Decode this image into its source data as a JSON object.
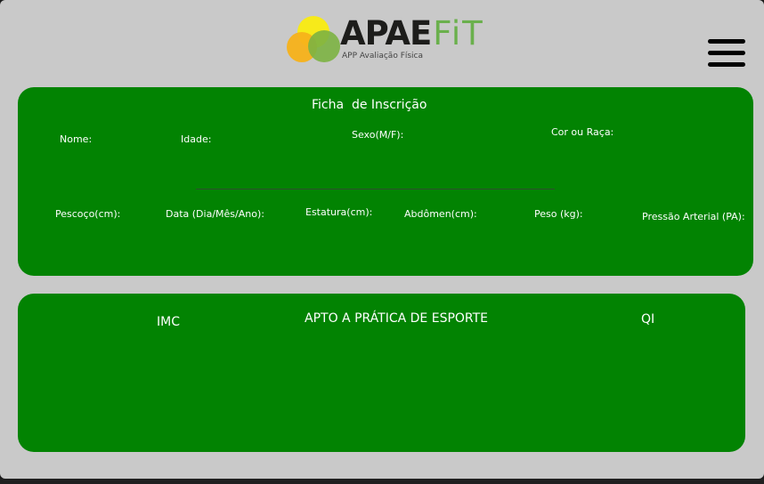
{
  "header": {
    "logo": {
      "wordmark_main": "APAE",
      "wordmark_accent": "FiT",
      "subtitle": "APP Avaliação Física",
      "icon": "overlapping-circles-logo-icon"
    },
    "menu_icon": "hamburger-menu-icon"
  },
  "form_panel": {
    "title": "Ficha  de Inscrição",
    "row1": {
      "name_label": "Nome:",
      "age_label": "Idade:",
      "sex_label": "Sexo(M/F):",
      "race_label": "Cor ou Raça:"
    },
    "row2": {
      "neck_label": "Pescoço(cm):",
      "date_label": "Data (Dia/Mês/Ano):",
      "height_label": "Estatura(cm):",
      "abdomen_label": "Abdômen(cm):",
      "weight_label": "Peso (kg):",
      "blood_pressure_label": "Pressão Arterial (PA):"
    }
  },
  "result_panel": {
    "imc_label": "IMC",
    "fitness_label": "APTO A PRÁTICA DE ESPORTE",
    "qi_label": "QI"
  },
  "colors": {
    "background": "#c9c9c9",
    "panel_green": "#028302",
    "logo_yellow": "#f7ea1a",
    "logo_orange": "#f7b21a",
    "logo_green": "#7cb342",
    "wordmark_dark": "#1d1d1b",
    "wordmark_accent": "#6ab04c"
  }
}
